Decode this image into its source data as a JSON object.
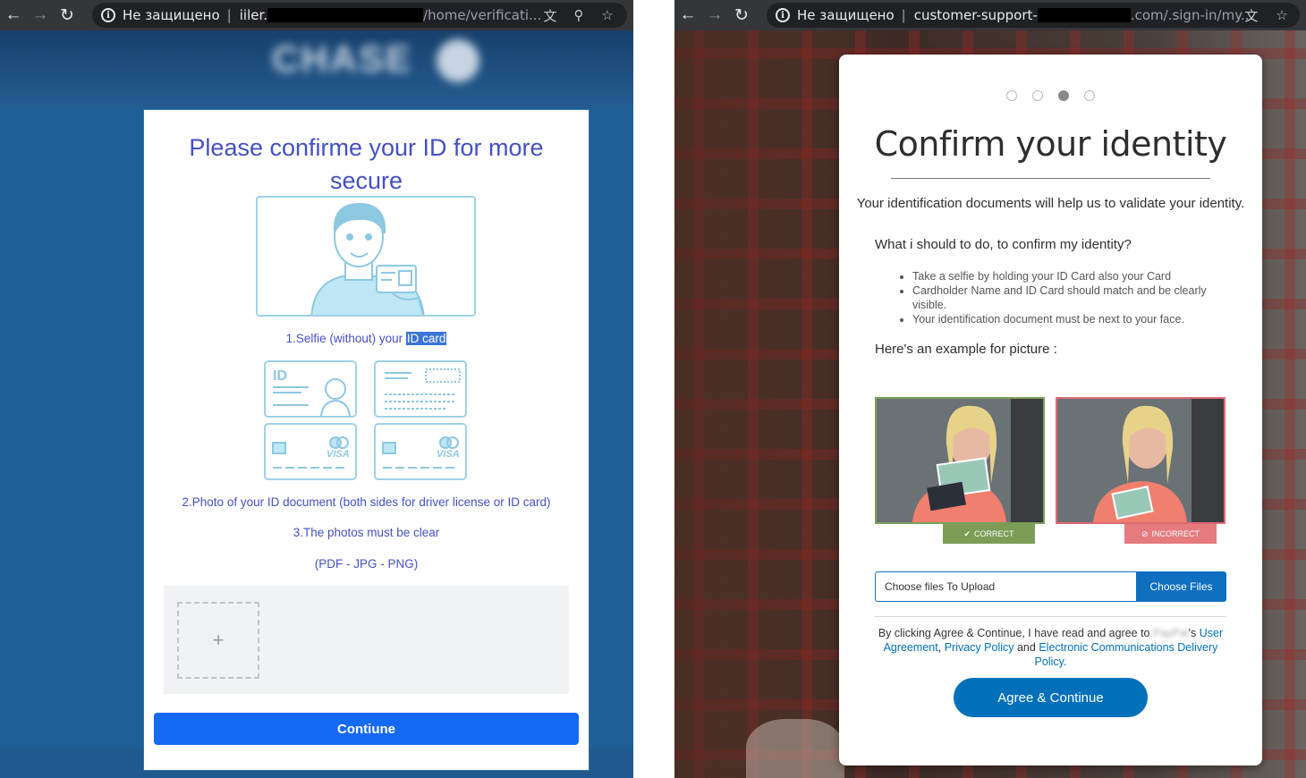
{
  "left": {
    "browser": {
      "security_label": "Не защищено",
      "url_prefix": "iiler.",
      "url_suffix": "/home/verificati..."
    },
    "card": {
      "title": "Please confirme your ID for more secure",
      "step1_prefix": "1.Selfie (without) your ",
      "step1_highlight": "ID card",
      "step2": "2.Photo of your ID document (both sides for driver license or ID card)",
      "step3": "3.The photos must be clear",
      "formats": "(PDF - JPG - PNG)",
      "upload_plus": "+",
      "continue_label": "Contiune"
    }
  },
  "right": {
    "browser": {
      "security_label": "Не защищено",
      "url_prefix": "customer-support-",
      "url_suffix": ".com/.sign-in/my..."
    },
    "card": {
      "title": "Confirm your identity",
      "subtitle": "Your identification documents will help us to validate your identity.",
      "question": "What i should to do, to confirm my identity?",
      "instructions": [
        "Take a selfie by holding your ID Card also your Card",
        "Cardholder Name and ID Card should match and be clearly visible.",
        "Your identification document must be next to your face."
      ],
      "example_label": "Here's an example for picture :",
      "correct_label": "CORRECT",
      "incorrect_label": "INCORRECT",
      "file_placeholder": "Choose files To Upload",
      "file_button": "Choose Files",
      "legal_prefix": "By clicking Agree & Continue, I have read and agree to",
      "legal_brand_suffix": "'s",
      "legal_link_user_agreement": "User Agreement",
      "legal_comma": ",",
      "legal_link_privacy": "Privacy Policy",
      "legal_and": "and",
      "legal_link_ecd": "Electronic Communications Delivery Policy.",
      "agree_label": "Agree & Continue",
      "progress_step_active": 3,
      "progress_step_total": 4
    }
  },
  "colors": {
    "left_accent": "#4450c6",
    "left_button": "#1469f5",
    "right_button": "#0070ba",
    "correct": "#7b9d55",
    "incorrect": "#e57b7f"
  }
}
